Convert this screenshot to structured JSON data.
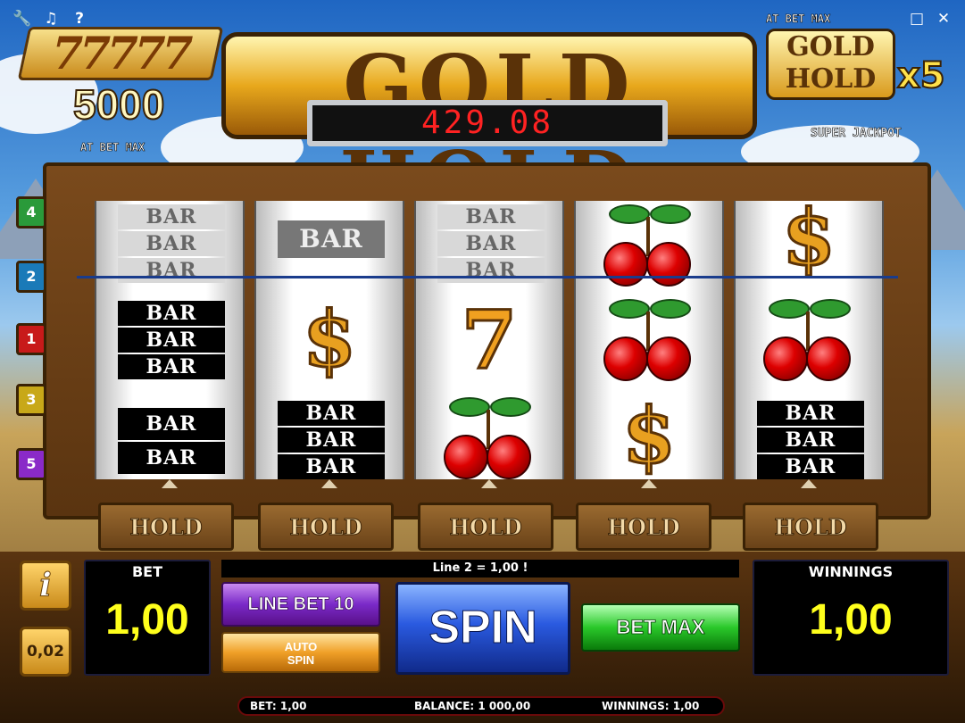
{
  "window": {
    "help_label": "?"
  },
  "jackpot_left": {
    "sevens": "77777",
    "amount": "5000",
    "caption": "AT BET MAX"
  },
  "logo": {
    "title": "GOLD HOLD",
    "counter": "429.08"
  },
  "jackpot_right": {
    "caption_top": "AT BET MAX",
    "logo": "GOLD HOLD",
    "multiplier": "x5",
    "caption_bottom": "SUPER JACKPOT"
  },
  "paylines": [
    "4",
    "2",
    "1",
    "3",
    "5"
  ],
  "reels": {
    "bar": "BAR",
    "seven": "7",
    "dollar": "$"
  },
  "hold_label": "HOLD",
  "controls": {
    "info": "i",
    "coin": "0,02",
    "bet_title": "BET",
    "bet_value": "1,00",
    "message": "Line 2 = 1,00 !",
    "line_bet": "LINE BET 10",
    "auto_spin_1": "AUTO",
    "auto_spin_2": "SPIN",
    "spin": "SPIN",
    "bet_max": "BET MAX",
    "winnings_title": "WINNINGS",
    "winnings_value": "1,00"
  },
  "status": {
    "bet": "BET: 1,00",
    "balance": "BALANCE: 1 000,00",
    "winnings": "WINNINGS: 1,00"
  },
  "colors": {
    "counter": "#ff2222",
    "value": "#ffff1c",
    "spin": "#2a5ae0",
    "bet_max": "#2ac82a",
    "line_bet": "#7a2ac8"
  }
}
